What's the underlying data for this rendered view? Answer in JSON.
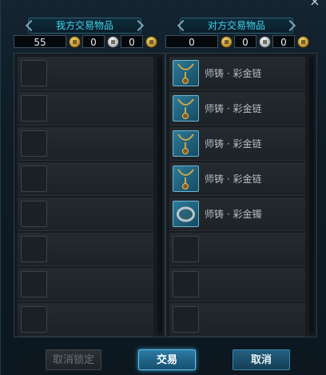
{
  "left_panel": {
    "title": "我方交易物品",
    "money": {
      "gold": "55",
      "silver": "0",
      "copper": "0"
    },
    "rows": [
      {
        "name": ""
      },
      {
        "name": ""
      },
      {
        "name": ""
      },
      {
        "name": ""
      },
      {
        "name": ""
      },
      {
        "name": ""
      },
      {
        "name": ""
      },
      {
        "name": ""
      }
    ]
  },
  "right_panel": {
    "title": "对方交易物品",
    "money": {
      "gold": "0",
      "silver": "0",
      "copper": "0"
    },
    "rows": [
      {
        "name": "师铸 · 彩金链",
        "icon": "necklace-icon"
      },
      {
        "name": "师铸 · 彩金链",
        "icon": "necklace-icon"
      },
      {
        "name": "师铸 · 彩金链",
        "icon": "necklace-icon"
      },
      {
        "name": "师铸 · 彩金链",
        "icon": "necklace-icon"
      },
      {
        "name": "师铸 · 彩金镯",
        "icon": "bracelet-icon"
      },
      {
        "name": ""
      },
      {
        "name": ""
      },
      {
        "name": ""
      }
    ]
  },
  "buttons": {
    "unlock": "取消锁定",
    "trade": "交易",
    "cancel": "取消"
  },
  "close_label": "×"
}
